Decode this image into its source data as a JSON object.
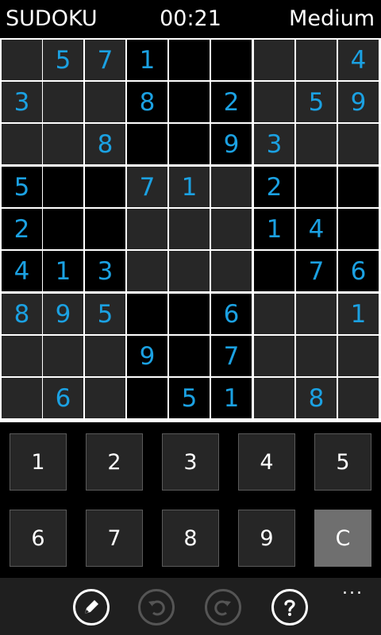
{
  "header": {
    "title": "SUDOKU",
    "timer": "00:21",
    "difficulty": "Medium"
  },
  "board": {
    "rows": [
      [
        "",
        "5",
        "7",
        "1",
        "",
        "",
        "",
        "",
        "4"
      ],
      [
        "3",
        "",
        "",
        "8",
        "",
        "2",
        "",
        "5",
        "9"
      ],
      [
        "",
        "",
        "8",
        "",
        "",
        "9",
        "3",
        "",
        ""
      ],
      [
        "5",
        "",
        "",
        "7",
        "1",
        "",
        "2",
        "",
        ""
      ],
      [
        "2",
        "",
        "",
        "",
        "",
        "",
        "1",
        "4",
        ""
      ],
      [
        "4",
        "1",
        "3",
        "",
        "",
        "",
        "",
        "7",
        "6"
      ],
      [
        "8",
        "9",
        "5",
        "",
        "",
        "6",
        "",
        "",
        "1"
      ],
      [
        "",
        "",
        "",
        "9",
        "",
        "7",
        "",
        "",
        ""
      ],
      [
        "",
        "6",
        "",
        "",
        "5",
        "1",
        "",
        "8",
        ""
      ]
    ]
  },
  "keypad": {
    "keys": [
      "1",
      "2",
      "3",
      "4",
      "5",
      "6",
      "7",
      "8",
      "9",
      "C"
    ]
  },
  "appbar": {
    "buttons": [
      {
        "icon": "pencil-icon",
        "enabled": true
      },
      {
        "icon": "undo-icon",
        "enabled": false
      },
      {
        "icon": "redo-icon",
        "enabled": false
      },
      {
        "icon": "help-icon",
        "enabled": true
      }
    ],
    "more": "..."
  },
  "colors": {
    "given_digit": "#1ba1e2",
    "light_box": "#272727",
    "dark_box": "#000000",
    "grid_line": "#ffffff",
    "clear_key": "#6f6f6f"
  }
}
